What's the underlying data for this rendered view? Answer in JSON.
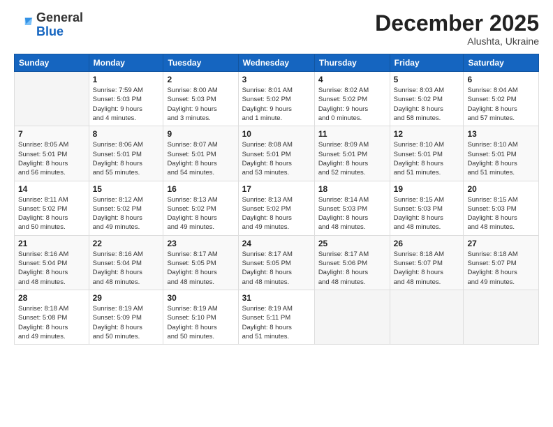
{
  "header": {
    "logo_general": "General",
    "logo_blue": "Blue",
    "month_title": "December 2025",
    "subtitle": "Alushta, Ukraine"
  },
  "weekdays": [
    "Sunday",
    "Monday",
    "Tuesday",
    "Wednesday",
    "Thursday",
    "Friday",
    "Saturday"
  ],
  "weeks": [
    [
      {
        "day": "",
        "info": ""
      },
      {
        "day": "1",
        "info": "Sunrise: 7:59 AM\nSunset: 5:03 PM\nDaylight: 9 hours\nand 4 minutes."
      },
      {
        "day": "2",
        "info": "Sunrise: 8:00 AM\nSunset: 5:03 PM\nDaylight: 9 hours\nand 3 minutes."
      },
      {
        "day": "3",
        "info": "Sunrise: 8:01 AM\nSunset: 5:02 PM\nDaylight: 9 hours\nand 1 minute."
      },
      {
        "day": "4",
        "info": "Sunrise: 8:02 AM\nSunset: 5:02 PM\nDaylight: 9 hours\nand 0 minutes."
      },
      {
        "day": "5",
        "info": "Sunrise: 8:03 AM\nSunset: 5:02 PM\nDaylight: 8 hours\nand 58 minutes."
      },
      {
        "day": "6",
        "info": "Sunrise: 8:04 AM\nSunset: 5:02 PM\nDaylight: 8 hours\nand 57 minutes."
      }
    ],
    [
      {
        "day": "7",
        "info": "Sunrise: 8:05 AM\nSunset: 5:01 PM\nDaylight: 8 hours\nand 56 minutes."
      },
      {
        "day": "8",
        "info": "Sunrise: 8:06 AM\nSunset: 5:01 PM\nDaylight: 8 hours\nand 55 minutes."
      },
      {
        "day": "9",
        "info": "Sunrise: 8:07 AM\nSunset: 5:01 PM\nDaylight: 8 hours\nand 54 minutes."
      },
      {
        "day": "10",
        "info": "Sunrise: 8:08 AM\nSunset: 5:01 PM\nDaylight: 8 hours\nand 53 minutes."
      },
      {
        "day": "11",
        "info": "Sunrise: 8:09 AM\nSunset: 5:01 PM\nDaylight: 8 hours\nand 52 minutes."
      },
      {
        "day": "12",
        "info": "Sunrise: 8:10 AM\nSunset: 5:01 PM\nDaylight: 8 hours\nand 51 minutes."
      },
      {
        "day": "13",
        "info": "Sunrise: 8:10 AM\nSunset: 5:01 PM\nDaylight: 8 hours\nand 51 minutes."
      }
    ],
    [
      {
        "day": "14",
        "info": "Sunrise: 8:11 AM\nSunset: 5:02 PM\nDaylight: 8 hours\nand 50 minutes."
      },
      {
        "day": "15",
        "info": "Sunrise: 8:12 AM\nSunset: 5:02 PM\nDaylight: 8 hours\nand 49 minutes."
      },
      {
        "day": "16",
        "info": "Sunrise: 8:13 AM\nSunset: 5:02 PM\nDaylight: 8 hours\nand 49 minutes."
      },
      {
        "day": "17",
        "info": "Sunrise: 8:13 AM\nSunset: 5:02 PM\nDaylight: 8 hours\nand 49 minutes."
      },
      {
        "day": "18",
        "info": "Sunrise: 8:14 AM\nSunset: 5:03 PM\nDaylight: 8 hours\nand 48 minutes."
      },
      {
        "day": "19",
        "info": "Sunrise: 8:15 AM\nSunset: 5:03 PM\nDaylight: 8 hours\nand 48 minutes."
      },
      {
        "day": "20",
        "info": "Sunrise: 8:15 AM\nSunset: 5:03 PM\nDaylight: 8 hours\nand 48 minutes."
      }
    ],
    [
      {
        "day": "21",
        "info": "Sunrise: 8:16 AM\nSunset: 5:04 PM\nDaylight: 8 hours\nand 48 minutes."
      },
      {
        "day": "22",
        "info": "Sunrise: 8:16 AM\nSunset: 5:04 PM\nDaylight: 8 hours\nand 48 minutes."
      },
      {
        "day": "23",
        "info": "Sunrise: 8:17 AM\nSunset: 5:05 PM\nDaylight: 8 hours\nand 48 minutes."
      },
      {
        "day": "24",
        "info": "Sunrise: 8:17 AM\nSunset: 5:05 PM\nDaylight: 8 hours\nand 48 minutes."
      },
      {
        "day": "25",
        "info": "Sunrise: 8:17 AM\nSunset: 5:06 PM\nDaylight: 8 hours\nand 48 minutes."
      },
      {
        "day": "26",
        "info": "Sunrise: 8:18 AM\nSunset: 5:07 PM\nDaylight: 8 hours\nand 48 minutes."
      },
      {
        "day": "27",
        "info": "Sunrise: 8:18 AM\nSunset: 5:07 PM\nDaylight: 8 hours\nand 49 minutes."
      }
    ],
    [
      {
        "day": "28",
        "info": "Sunrise: 8:18 AM\nSunset: 5:08 PM\nDaylight: 8 hours\nand 49 minutes."
      },
      {
        "day": "29",
        "info": "Sunrise: 8:19 AM\nSunset: 5:09 PM\nDaylight: 8 hours\nand 50 minutes."
      },
      {
        "day": "30",
        "info": "Sunrise: 8:19 AM\nSunset: 5:10 PM\nDaylight: 8 hours\nand 50 minutes."
      },
      {
        "day": "31",
        "info": "Sunrise: 8:19 AM\nSunset: 5:11 PM\nDaylight: 8 hours\nand 51 minutes."
      },
      {
        "day": "",
        "info": ""
      },
      {
        "day": "",
        "info": ""
      },
      {
        "day": "",
        "info": ""
      }
    ]
  ]
}
